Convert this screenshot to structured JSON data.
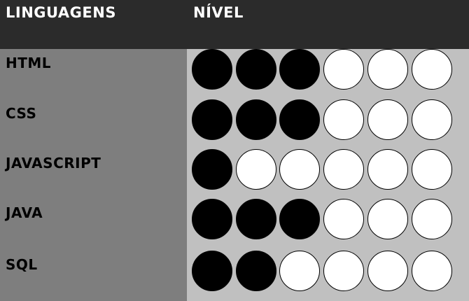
{
  "header": {
    "languages_label": "LINGUAGENS",
    "level_label": "NÍVEL"
  },
  "rows": [
    {
      "name": "HTML",
      "level": 3,
      "max": 6
    },
    {
      "name": "CSS",
      "level": 3,
      "max": 6
    },
    {
      "name": "JAVASCRIPT",
      "level": 1,
      "max": 6
    },
    {
      "name": "JAVA",
      "level": 3,
      "max": 6
    },
    {
      "name": "SQL",
      "level": 2,
      "max": 6
    }
  ],
  "colors": {
    "header_bg": "#2b2b2b",
    "left_bg": "#7e7e7e",
    "right_bg": "#c0c0c0",
    "filled": "#000000",
    "empty": "#ffffff"
  }
}
